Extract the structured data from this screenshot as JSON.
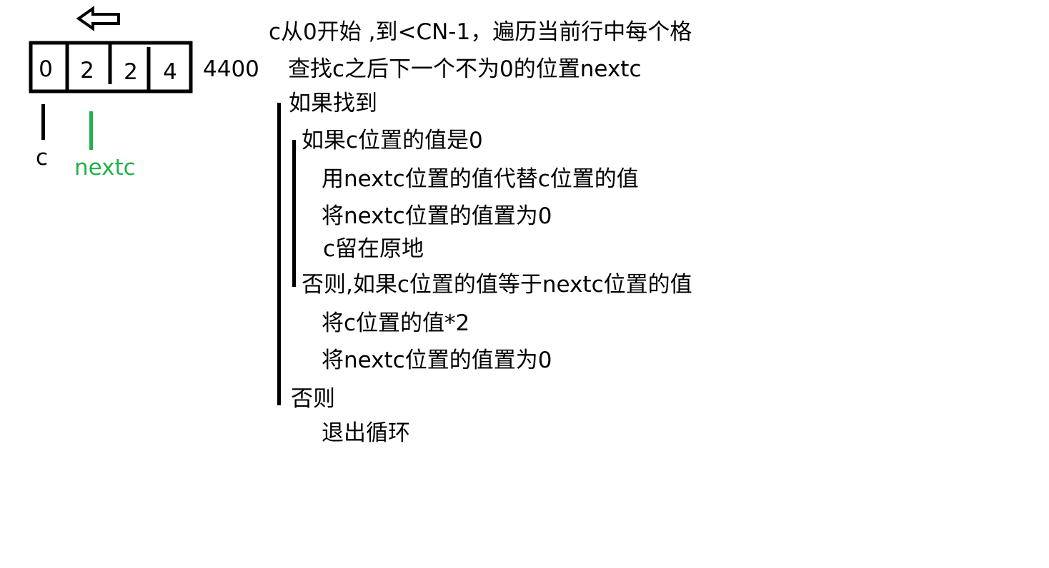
{
  "colors": {
    "pointer_c": "#000000",
    "pointer_nextc": "#22b14c"
  },
  "icons": {
    "direction_arrow": "left-arrow-icon"
  },
  "cells": [
    "0",
    "2",
    "2",
    "4"
  ],
  "result_label": "4400",
  "pointers": {
    "c": "c",
    "nextc": "nextc"
  },
  "code": [
    "c从0开始 ,到<CN-1，遍历当前行中每个格",
    "查找c之后下一个不为0的位置nextc",
    "如果找到",
    "如果c位置的值是0",
    "用nextc位置的值代替c位置的值",
    "将nextc位置的值置为0",
    "c留在原地",
    "否则,如果c位置的值等于nextc位置的值",
    "将c位置的值*2",
    "将nextc位置的值置为0",
    "否则",
    "退出循环"
  ]
}
